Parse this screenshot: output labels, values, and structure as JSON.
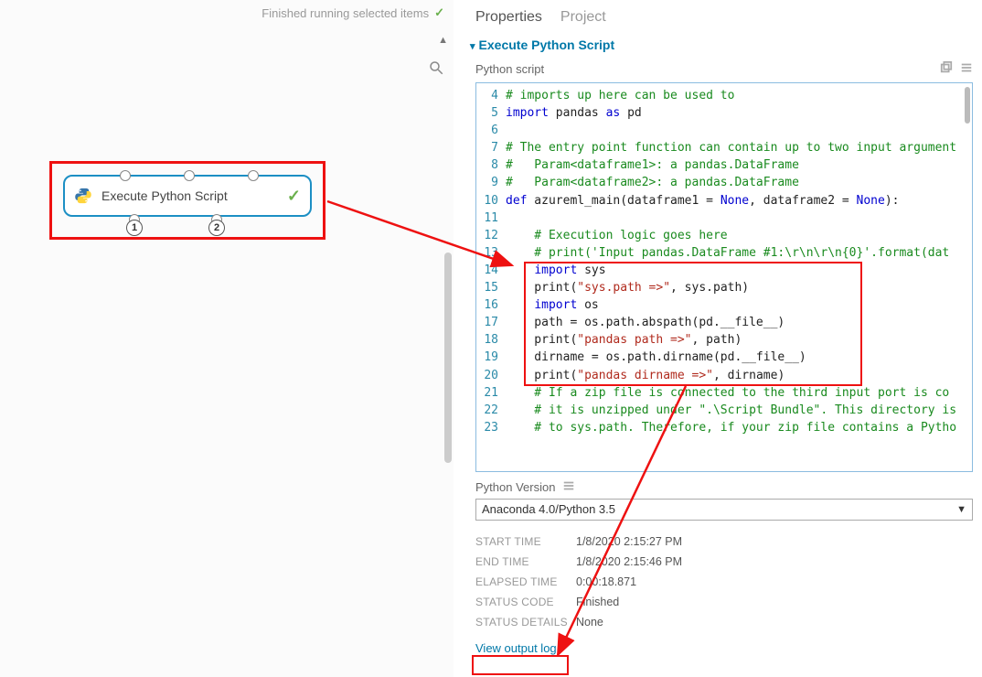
{
  "canvas": {
    "status_text": "Finished running selected items",
    "node_title": "Execute Python Script",
    "port_label_1": "1",
    "port_label_2": "2"
  },
  "tabs": {
    "properties": "Properties",
    "project": "Project"
  },
  "section": {
    "title": "Execute Python Script"
  },
  "script": {
    "label": "Python script",
    "lines": [
      {
        "n": 4,
        "cls": "comment",
        "text": "# imports up here can be used to"
      },
      {
        "n": 5,
        "cls": "code",
        "html": "<span class='tok-key'>import</span> pandas <span class='tok-key'>as</span> pd"
      },
      {
        "n": 6,
        "cls": "blank",
        "text": ""
      },
      {
        "n": 7,
        "cls": "comment",
        "text": "# The entry point function can contain up to two input argument"
      },
      {
        "n": 8,
        "cls": "comment",
        "html": "<span class='tok-comment'>#   Param&lt;dataframe1&gt;: a pandas.DataFrame</span>"
      },
      {
        "n": 9,
        "cls": "comment",
        "html": "<span class='tok-comment'>#   Param&lt;dataframe2&gt;: a pandas.DataFrame</span>"
      },
      {
        "n": 10,
        "cls": "code",
        "html": "<span class='tok-key'>def</span> azureml_main(dataframe1 = <span class='tok-key'>None</span>, dataframe2 = <span class='tok-key'>None</span>):"
      },
      {
        "n": 11,
        "cls": "blank",
        "text": ""
      },
      {
        "n": 12,
        "cls": "comment",
        "text": "    # Execution logic goes here"
      },
      {
        "n": 13,
        "cls": "comment",
        "text": "    # print('Input pandas.DataFrame #1:\\r\\n\\r\\n{0}'.format(dat"
      },
      {
        "n": 14,
        "cls": "code",
        "html": "    <span class='tok-key'>import</span> sys"
      },
      {
        "n": 15,
        "cls": "code",
        "html": "    print(<span class='tok-str'>\"sys.path =&gt;\"</span>, sys.path)"
      },
      {
        "n": 16,
        "cls": "code",
        "html": "    <span class='tok-key'>import</span> os"
      },
      {
        "n": 17,
        "cls": "code",
        "html": "    path = os.path.abspath(pd.__file__)"
      },
      {
        "n": 18,
        "cls": "code",
        "html": "    print(<span class='tok-str'>\"pandas path =&gt;\"</span>, path)"
      },
      {
        "n": 19,
        "cls": "code",
        "html": "    dirname = os.path.dirname(pd.__file__)"
      },
      {
        "n": 20,
        "cls": "code",
        "html": "    print(<span class='tok-str'>\"pandas dirname =&gt;\"</span>, dirname)"
      },
      {
        "n": 21,
        "cls": "comment",
        "text": "    # If a zip file is connected to the third input port is co"
      },
      {
        "n": 22,
        "cls": "comment",
        "text": "    # it is unzipped under \".\\Script Bundle\". This directory is"
      },
      {
        "n": 23,
        "cls": "comment",
        "text": "    # to sys.path. Therefore, if your zip file contains a Pytho"
      }
    ]
  },
  "python_version": {
    "label": "Python Version",
    "value": "Anaconda 4.0/Python 3.5"
  },
  "meta": {
    "start_time_key": "START TIME",
    "start_time_val": "1/8/2020 2:15:27 PM",
    "end_time_key": "END TIME",
    "end_time_val": "1/8/2020 2:15:46 PM",
    "elapsed_key": "ELAPSED TIME",
    "elapsed_val": "0:00:18.871",
    "status_code_key": "STATUS CODE",
    "status_code_val": "Finished",
    "status_details_key": "STATUS DETAILS",
    "status_details_val": "None"
  },
  "links": {
    "view_output_log": "View output log"
  }
}
